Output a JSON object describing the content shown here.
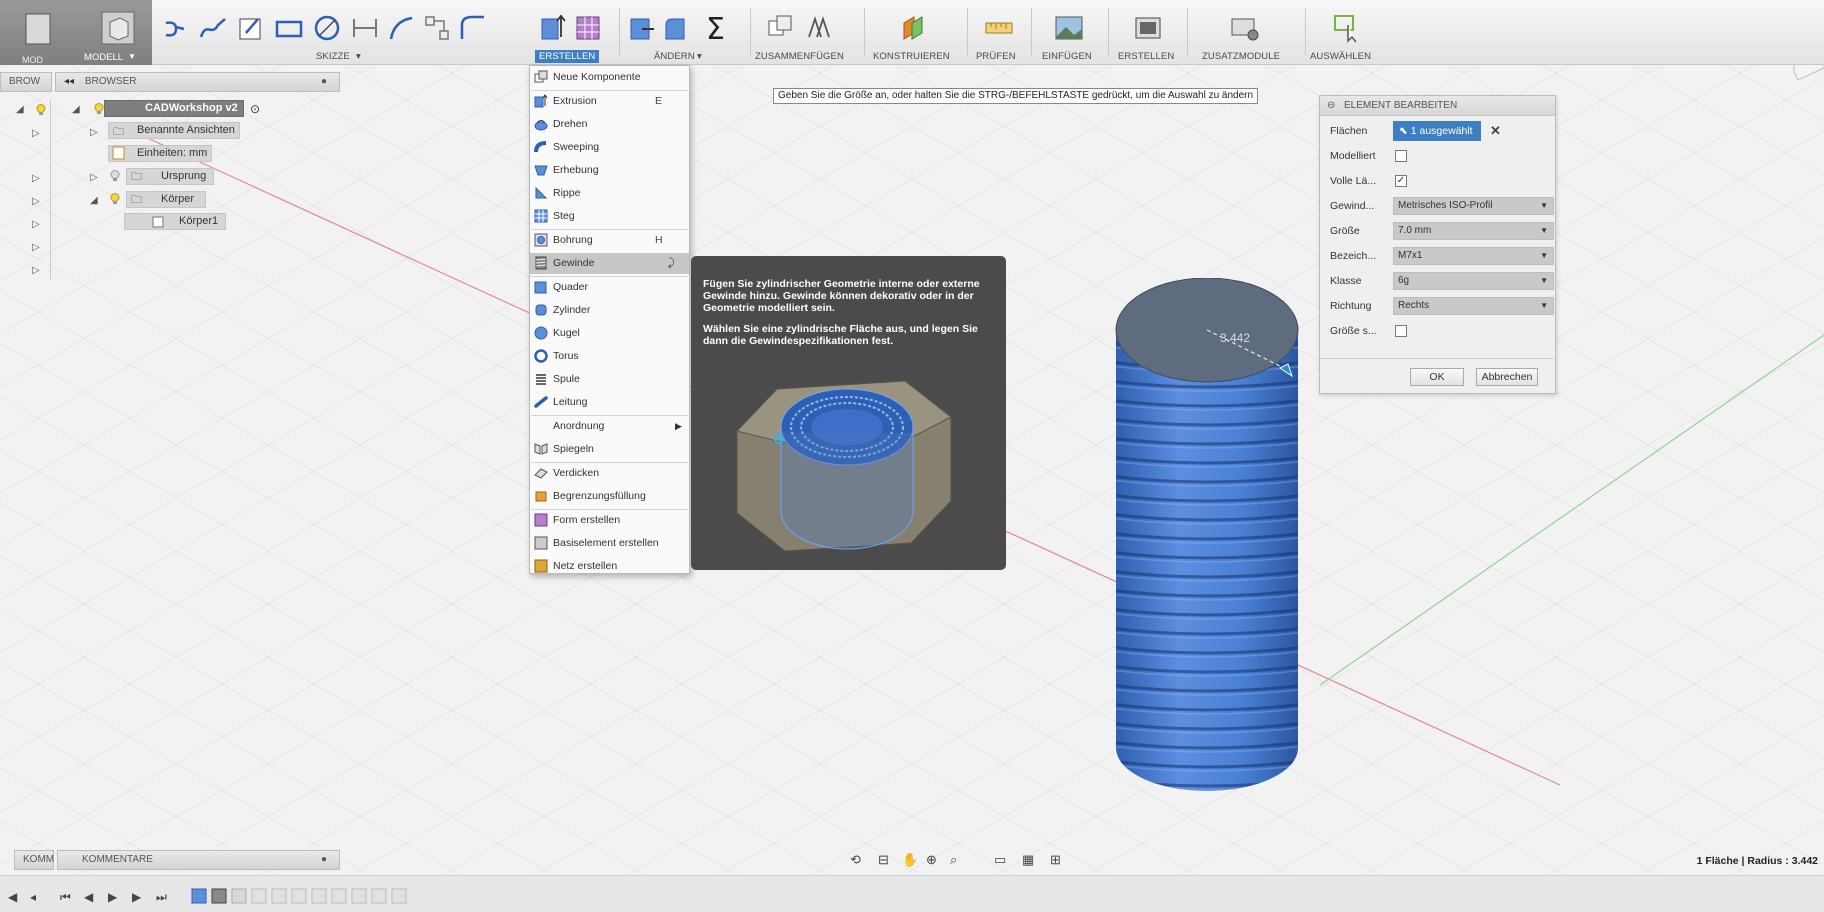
{
  "toolbar": {
    "workspace_short": "MOD",
    "workspace": "MODELL",
    "groups": [
      {
        "label": "SKIZZE"
      },
      {
        "label": "ERSTELLEN"
      },
      {
        "label": "ÄNDERN"
      },
      {
        "label": "ZUSAMMENFÜGEN"
      },
      {
        "label": "KONSTRUIEREN"
      },
      {
        "label": "PRÜFEN"
      },
      {
        "label": "EINFÜGEN"
      },
      {
        "label": "ERSTELLEN"
      },
      {
        "label": "ZUSATZMODULE"
      },
      {
        "label": "AUSWÄHLEN"
      }
    ],
    "sigma": "Σ"
  },
  "browser": {
    "collapsed_label": "BROW",
    "title": "BROWSER",
    "root": "CADWorkshop v2",
    "items": [
      {
        "label": "Benannte Ansichten"
      },
      {
        "label": "Einheiten: mm"
      },
      {
        "label": "Ursprung"
      },
      {
        "label": "Körper"
      },
      {
        "label": "Körper1"
      }
    ]
  },
  "comments": {
    "collapsed_label": "KOMM",
    "title": "KOMMENTARE"
  },
  "hint": "Geben Sie die Größe an, oder halten Sie die STRG-/BEFEHLSTASTE gedrückt, um die Auswahl zu ändern",
  "menu": {
    "items": [
      {
        "label": "Neue Komponente",
        "shortcut": ""
      },
      {
        "label": "Extrusion",
        "shortcut": "E"
      },
      {
        "label": "Drehen",
        "shortcut": ""
      },
      {
        "label": "Sweeping",
        "shortcut": ""
      },
      {
        "label": "Erhebung",
        "shortcut": ""
      },
      {
        "label": "Rippe",
        "shortcut": ""
      },
      {
        "label": "Steg",
        "shortcut": ""
      },
      {
        "label": "Bohrung",
        "shortcut": "H"
      },
      {
        "label": "Gewinde",
        "shortcut": ""
      },
      {
        "label": "Quader",
        "shortcut": ""
      },
      {
        "label": "Zylinder",
        "shortcut": ""
      },
      {
        "label": "Kugel",
        "shortcut": ""
      },
      {
        "label": "Torus",
        "shortcut": ""
      },
      {
        "label": "Spule",
        "shortcut": ""
      },
      {
        "label": "Leitung",
        "shortcut": ""
      },
      {
        "label": "Anordnung",
        "shortcut": ""
      },
      {
        "label": "Spiegeln",
        "shortcut": ""
      },
      {
        "label": "Verdicken",
        "shortcut": ""
      },
      {
        "label": "Begrenzungsfüllung",
        "shortcut": ""
      },
      {
        "label": "Form erstellen",
        "shortcut": ""
      },
      {
        "label": "Basiselement erstellen",
        "shortcut": ""
      },
      {
        "label": "Netz erstellen",
        "shortcut": ""
      }
    ]
  },
  "tooltip": {
    "para1": "Fügen Sie zylindrischer Geometrie interne oder externe Gewinde hinzu. Gewinde können dekorativ oder in der Geometrie modelliert sein.",
    "para2": "Wählen Sie eine zylindrische Fläche aus, und legen Sie dann die Gewindespezifikationen fest."
  },
  "edit_panel": {
    "title": "ELEMENT BEARBEITEN",
    "faces_label": "Flächen",
    "faces_value": "1 ausgewählt",
    "modeled_label": "Modelliert",
    "full_length_label": "Volle Lä...",
    "thread_type_label": "Gewind...",
    "thread_type_value": "Metrisches ISO-Profil",
    "size_label": "Größe",
    "size_value": "7.0 mm",
    "designation_label": "Bezeich...",
    "designation_value": "M7x1",
    "class_label": "Klasse",
    "class_value": "6g",
    "direction_label": "Richtung",
    "direction_value": "Rechts",
    "size_s_label": "Größe s...",
    "ok": "OK",
    "cancel": "Abbrechen"
  },
  "model": {
    "dimension": "3.442"
  },
  "status": "1 Fläche | Radius : 3.442",
  "colors": {
    "accent": "#3d7fc2",
    "cylinder": "#4a7fd4",
    "cylinder_top": "#5f6c80"
  }
}
